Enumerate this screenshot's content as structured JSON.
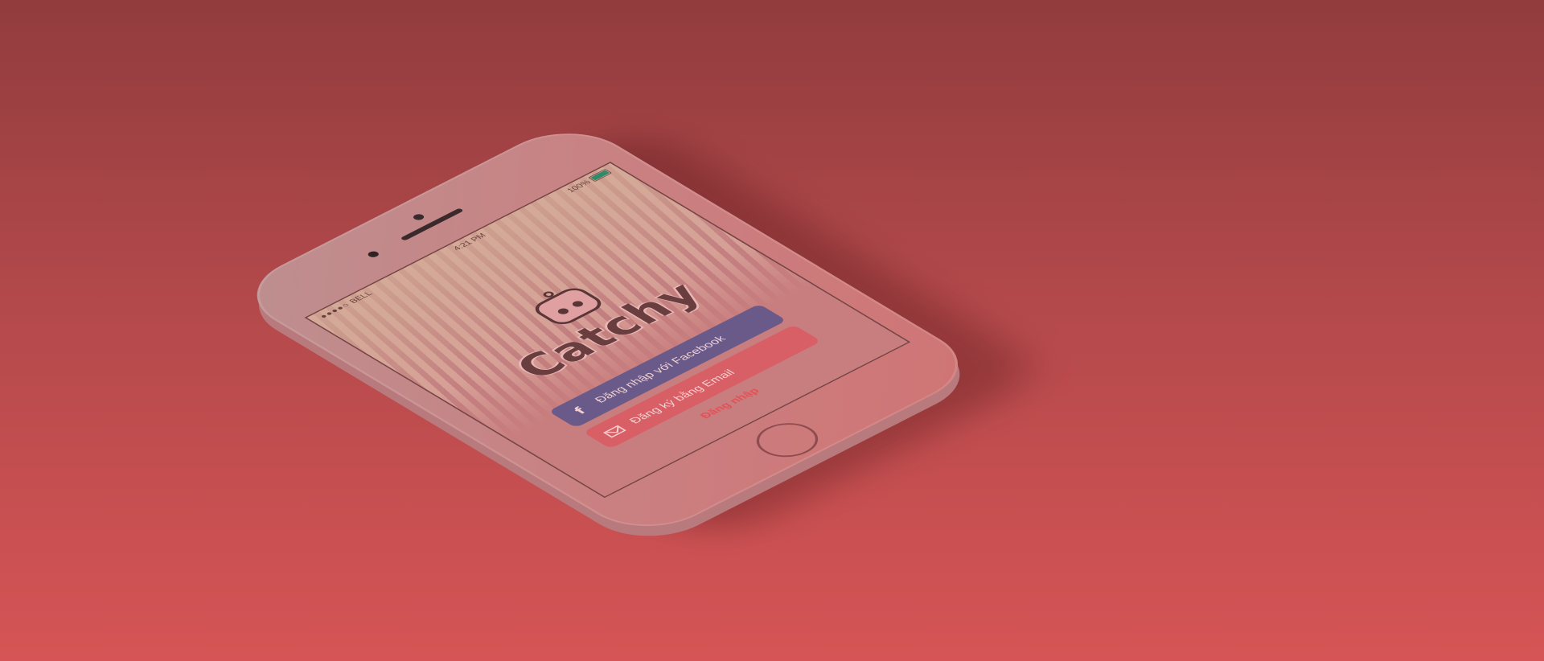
{
  "status_bar": {
    "carrier": "BELL",
    "time": "4:21 PM",
    "battery": "100%"
  },
  "app": {
    "logo_text": "Catchy"
  },
  "buttons": {
    "facebook_icon": "f",
    "facebook_label": "Đăng nhập với Facebook",
    "email_label": "Đăng ký bằng Email",
    "login_label": "Đăng nhập"
  },
  "icons": {
    "facebook": "facebook-icon",
    "email": "mail-icon",
    "battery": "battery-icon"
  },
  "colors": {
    "background_top": "#923c3e",
    "background_bottom": "#d65455",
    "facebook_button": "#6a5a8a",
    "email_button": "#d85f66",
    "login_link": "#e05258"
  }
}
